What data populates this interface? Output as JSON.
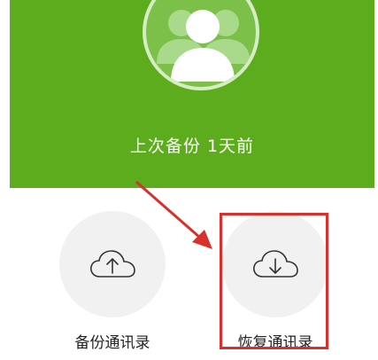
{
  "header": {
    "last_backup": "上次备份 1天前"
  },
  "actions": {
    "backup_label": "备份通讯录",
    "restore_label": "恢复通讯录"
  },
  "colors": {
    "header_green": "#5cac1e",
    "annotation_red": "#d9302c"
  },
  "icons": {
    "avatar": "contacts-group-icon",
    "backup": "cloud-upload-icon",
    "restore": "cloud-download-icon"
  }
}
